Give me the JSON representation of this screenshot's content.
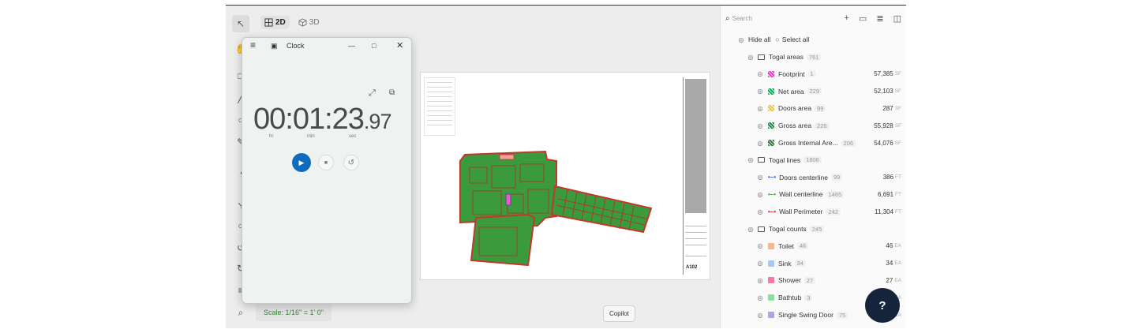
{
  "view_toggle": {
    "label_2d": "2D",
    "label_3d": "3D"
  },
  "clock": {
    "title": "Clock",
    "time_main": "00:01:23",
    "time_cs": ".97",
    "unit_hr": "hr",
    "unit_min": "min",
    "unit_sec": "sec"
  },
  "sheet": {
    "number": "A102"
  },
  "scale": {
    "label": "Scale: 1/16\" = 1' 0\""
  },
  "copilot": {
    "label": "Copilot"
  },
  "panel": {
    "search_placeholder": "Search",
    "hide_all": "Hide all",
    "select_all": "Select all",
    "groups": [
      {
        "name": "Togal areas",
        "count": "761",
        "items": [
          {
            "name": "Footprint",
            "count": "1",
            "value": "57,385",
            "unit": "SF",
            "color": "#e040c8",
            "kind": "area"
          },
          {
            "name": "Net area",
            "count": "229",
            "value": "52,103",
            "unit": "SF",
            "color": "#1fa85a",
            "kind": "area"
          },
          {
            "name": "Doors area",
            "count": "99",
            "value": "287",
            "unit": "SF",
            "color": "#f4c230",
            "kind": "area"
          },
          {
            "name": "Gross area",
            "count": "226",
            "value": "55,928",
            "unit": "SF",
            "color": "#1c8f46",
            "kind": "area"
          },
          {
            "name": "Gross Internal Are...",
            "count": "206",
            "value": "54,076",
            "unit": "SF",
            "color": "#2f7d3a",
            "kind": "area"
          }
        ]
      },
      {
        "name": "Togal lines",
        "count": "1806",
        "items": [
          {
            "name": "Doors centerline",
            "count": "99",
            "value": "386",
            "unit": "FT",
            "color": "#3b5bd9",
            "kind": "line"
          },
          {
            "name": "Wall centerline",
            "count": "1465",
            "value": "6,691",
            "unit": "FT",
            "color": "#3aa64a",
            "kind": "line"
          },
          {
            "name": "Wall Perimeter",
            "count": "242",
            "value": "11,304",
            "unit": "FT",
            "color": "#e02020",
            "kind": "line"
          }
        ]
      },
      {
        "name": "Togal counts",
        "count": "245",
        "items": [
          {
            "name": "Toilet",
            "count": "46",
            "value": "46",
            "unit": "EA",
            "color": "#f5b88a",
            "kind": "count"
          },
          {
            "name": "Sink",
            "count": "34",
            "value": "34",
            "unit": "EA",
            "color": "#a9c8f0",
            "kind": "count"
          },
          {
            "name": "Shower",
            "count": "27",
            "value": "27",
            "unit": "EA",
            "color": "#f07ba8",
            "kind": "count"
          },
          {
            "name": "Bathtub",
            "count": "3",
            "value": "3",
            "unit": "EA",
            "color": "#8fdca0",
            "kind": "count"
          },
          {
            "name": "Single Swing Door",
            "count": "75",
            "value": "75",
            "unit": "EA",
            "color": "#b5a3e0",
            "kind": "count"
          }
        ]
      }
    ]
  },
  "help": {
    "label": "?"
  }
}
